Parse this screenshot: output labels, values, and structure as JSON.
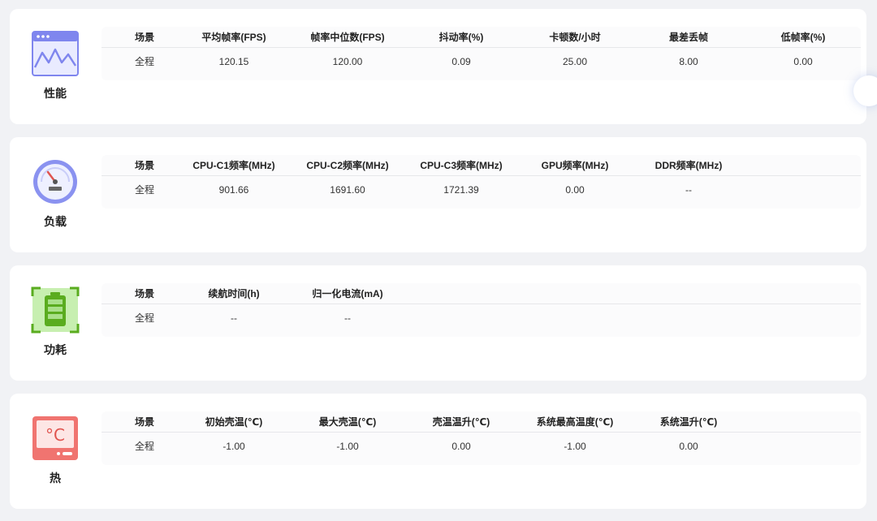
{
  "sections": [
    {
      "label": "性能",
      "icon": "performance-chart-icon",
      "headers": [
        "场景",
        "平均帧率(FPS)",
        "帧率中位数(FPS)",
        "抖动率(%)",
        "卡顿数/小时",
        "最差丢帧",
        "低帧率(%)"
      ],
      "row": [
        "全程",
        "120.15",
        "120.00",
        "0.09",
        "25.00",
        "8.00",
        "0.00"
      ]
    },
    {
      "label": "负载",
      "icon": "gauge-icon",
      "headers": [
        "场景",
        "CPU-C1频率(MHz)",
        "CPU-C2频率(MHz)",
        "CPU-C3频率(MHz)",
        "GPU频率(MHz)",
        "DDR频率(MHz)"
      ],
      "row": [
        "全程",
        "901.66",
        "1691.60",
        "1721.39",
        "0.00",
        "--"
      ]
    },
    {
      "label": "功耗",
      "icon": "battery-icon",
      "headers": [
        "场景",
        "续航时间(h)",
        "归一化电流(mA)"
      ],
      "row": [
        "全程",
        "--",
        "--"
      ]
    },
    {
      "label": "热",
      "icon": "thermometer-celsius-icon",
      "icon_text": "°C",
      "headers": [
        "场景",
        "初始壳温(℃)",
        "最大壳温(℃)",
        "壳温温升(℃)",
        "系统最高温度(℃)",
        "系统温升(℃)"
      ],
      "row": [
        "全程",
        "-1.00",
        "-1.00",
        "0.00",
        "-1.00",
        "0.00"
      ]
    }
  ],
  "colors": {
    "performance": "#7f86ee",
    "load": "#8a92f0",
    "power": "#5aac1f",
    "thermal": "#f07470"
  }
}
